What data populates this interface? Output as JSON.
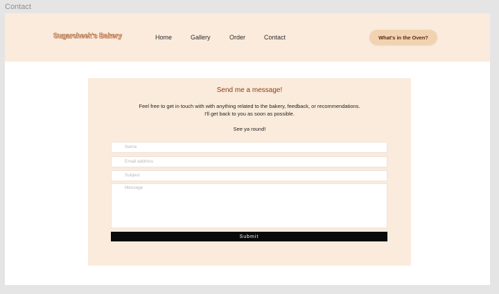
{
  "frame_label": "Contact",
  "nav": {
    "brand": "Sugarcheek's Bakery",
    "links": [
      "Home",
      "Gallery",
      "Order",
      "Contact"
    ],
    "cta": "What's in the Oven?"
  },
  "contact_card": {
    "title": "Send me a message!",
    "intro_line1": "Feel free to get in touch with with anything related to the bakery, feedback, or recommendations.",
    "intro_line2": "I'll get back to you as soon as possible.",
    "signoff": "See ya round!",
    "fields": {
      "name_placeholder": "Name",
      "email_placeholder": "Email address",
      "subject_placeholder": "Subject",
      "message_placeholder": "Message"
    },
    "submit_label": "Submit"
  },
  "colors": {
    "page_bg": "#e5e5e5",
    "nav_bg": "#faebdc",
    "card_bg": "#faebdc",
    "accent": "#8b3a12",
    "cta_bg": "#f1d3b1",
    "submit_bg": "#0a0a0a"
  }
}
